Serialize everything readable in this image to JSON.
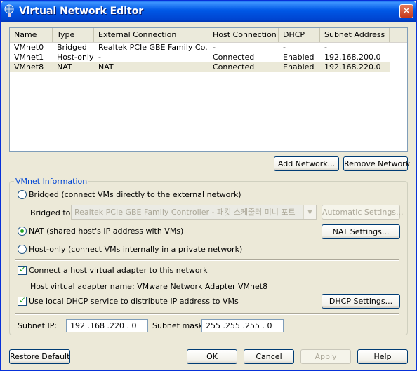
{
  "window": {
    "title": "Virtual Network Editor"
  },
  "table": {
    "columns": [
      "Name",
      "Type",
      "External Connection",
      "Host Connection",
      "DHCP",
      "Subnet Address"
    ],
    "rows": [
      {
        "name": "VMnet0",
        "type": "Bridged",
        "external": "Realtek PCIe GBE Family Co...",
        "host": "-",
        "dhcp": "-",
        "subnet": "-"
      },
      {
        "name": "VMnet1",
        "type": "Host-only",
        "external": "-",
        "host": "Connected",
        "dhcp": "Enabled",
        "subnet": "192.168.200.0"
      },
      {
        "name": "VMnet8",
        "type": "NAT",
        "external": "NAT",
        "host": "Connected",
        "dhcp": "Enabled",
        "subnet": "192.168.220.0",
        "selected": true
      }
    ]
  },
  "buttons": {
    "add_network": "Add Network...",
    "remove_network": "Remove Network",
    "automatic_settings": "Automatic Settings...",
    "nat_settings": "NAT Settings...",
    "dhcp_settings": "DHCP Settings...",
    "restore_default": "Restore Default",
    "ok": "OK",
    "cancel": "Cancel",
    "apply": "Apply",
    "help": "Help"
  },
  "vmnet_info": {
    "group_title": "VMnet Information",
    "bridged_label": "Bridged (connect VMs directly to the external network)",
    "bridged_to_label": "Bridged to:",
    "bridged_to_value": "Realtek PCIe GBE Family Controller - 패킷 스케줄러 미니 포트",
    "nat_label": "NAT (shared host's IP address with VMs)",
    "hostonly_label": "Host-only (connect VMs internally in a private network)",
    "selected_mode": "NAT",
    "connect_adapter_label": "Connect a host virtual adapter to this network",
    "connect_adapter_checked": true,
    "adapter_name_text": "Host virtual adapter name: VMware Network Adapter VMnet8",
    "dhcp_label": "Use local DHCP service to distribute IP address to VMs",
    "dhcp_checked": true,
    "subnet_ip_label": "Subnet IP:",
    "subnet_ip": "192 .168 .220 .  0",
    "subnet_mask_label": "Subnet mask:",
    "subnet_mask": "255 .255 .255 .  0"
  },
  "colors": {
    "titlebar": "#0058e6",
    "group_title": "#0046d5",
    "selection": "#ebe9d8"
  }
}
